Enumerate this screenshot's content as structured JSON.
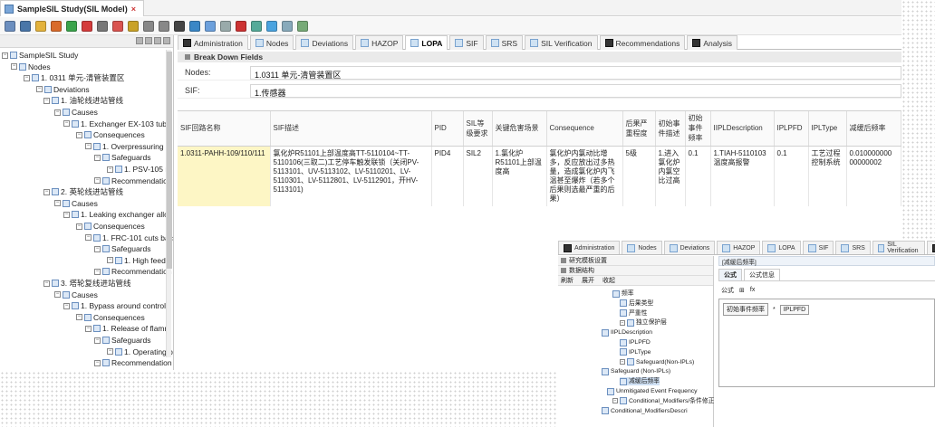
{
  "window": {
    "title": "SampleSIL Study(SIL Model)"
  },
  "tree": {
    "root": "SampleSIL Study",
    "nodes_label": "Nodes",
    "node1": "1. 0311 单元-清管装置区",
    "deviations": "Deviations",
    "dev1": "1. 油轮线进站管线",
    "causes": "Causes",
    "cause1": "1. Exchanger EX-103 tube",
    "consequences": "Consequences",
    "conseq1": "1. Overpressuring o",
    "safeguards": "Safeguards",
    "sg1": "1. PSV-105 re",
    "recommendations": "Recommendation",
    "dev2": "2. 英轮线进站管线",
    "cause2": "1. Leaking exchanger allov",
    "conseq2": "1. FRC-101 cuts bac",
    "sg2": "1. High feed s",
    "dev3": "3. 塔轮复线进站管线",
    "cause3": "1. Bypass around control ·",
    "conseq3": "1. Release of flamm",
    "sg3": "1. Operating p"
  },
  "tabs": [
    "Administration",
    "Nodes",
    "Deviations",
    "HAZOP",
    "LOPA",
    "SIF",
    "SRS",
    "SIL Verification",
    "Recommendations",
    "Analysis"
  ],
  "active_tab": "LOPA",
  "breakdown": {
    "header": "Break Down Fields",
    "nodes_label": "Nodes:",
    "nodes_value": "1.0311 单元-清管装置区",
    "sif_label": "SIF:",
    "sif_value": "1.传感器"
  },
  "grid": {
    "headers": [
      "SIF回路名称",
      "SIF描述",
      "PID",
      "SIL等级要求",
      "关键危害场景",
      "Consequence",
      "后果严重程度",
      "初始事件描述",
      "初始事件频率",
      "IIPLDescription",
      "IPLPFD",
      "IPLType",
      "减缓后频率"
    ],
    "row": [
      "1.0311-PAHH-109/110/111",
      "氯化炉R51101上部温度高TT-5110104~TT-5110106(三取二)工艺停车触发联锁（关闭PV-5113101、UV-5113102、LV-5110201、LV-5110301、LV-5112801、LV-5112901，开HV-5113101)",
      "PID4",
      "SIL2",
      "1.氯化炉R51101上部温度高",
      "氯化炉内氯动比增多，反应放出过多热量，造成氯化炉内飞温甚至爆炸（若多个后果则选最严重的后果）",
      "5级",
      "1.进入氯化炉内氯空比过高",
      "0.1",
      "1.TIAH-5110103温度高报警",
      "0.1",
      "工艺过程控制系统",
      "0.010000000 00000002"
    ]
  },
  "second": {
    "tabs": [
      "Administration",
      "Nodes",
      "Deviations",
      "HAZOP",
      "LOPA",
      "SIF",
      "SRS",
      "SIL Verification",
      "Reco"
    ],
    "bar1": "研究模板设置",
    "bar2": "数据结构",
    "actions": [
      "刷新",
      "展开",
      "收起"
    ],
    "tree": [
      "频率",
      "后果类型",
      "严重性",
      "独立保护层",
      "IIPLDescription",
      "IPLPFD",
      "IPLType",
      "Safeguard(Non-IPLs)",
      "Safeguard (Non-IPLs)",
      "减缓后频率",
      "Unmitigated Event Frequency",
      "Conditional_Modifiers/条件修正",
      "Conditional_ModifiersDescri"
    ],
    "formula_title": "[减缓后频率]",
    "subtabs": [
      "公式",
      "公式信息"
    ],
    "ftool": [
      "公式",
      "fx"
    ],
    "tokens": [
      "初始事件频率",
      "*",
      "IPLPFD"
    ]
  }
}
